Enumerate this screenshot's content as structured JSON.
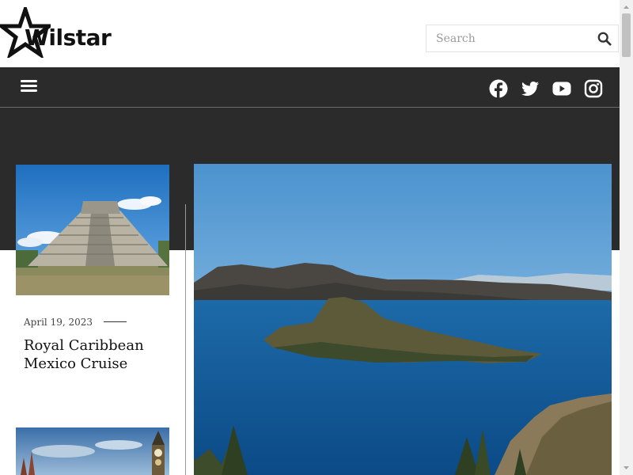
{
  "brand": {
    "name": "Wilstar"
  },
  "search": {
    "placeholder": "Search"
  },
  "nav": {
    "menu_icon": "hamburger-menu-icon",
    "social": [
      "facebook-icon",
      "twitter-icon",
      "youtube-icon",
      "instagram-icon"
    ]
  },
  "posts": [
    {
      "date": "April 19, 2023",
      "title": "Royal Caribbean Mexico Cruise",
      "image": "chichen-itza-pyramid"
    },
    {
      "date": "",
      "title": "",
      "image": "london-big-ben-skyline"
    }
  ],
  "hero": {
    "image": "crater-lake-wizard-island"
  },
  "colors": {
    "nav_bg": "#2b2b2b",
    "text": "#111111",
    "accent": "#ffffff"
  }
}
